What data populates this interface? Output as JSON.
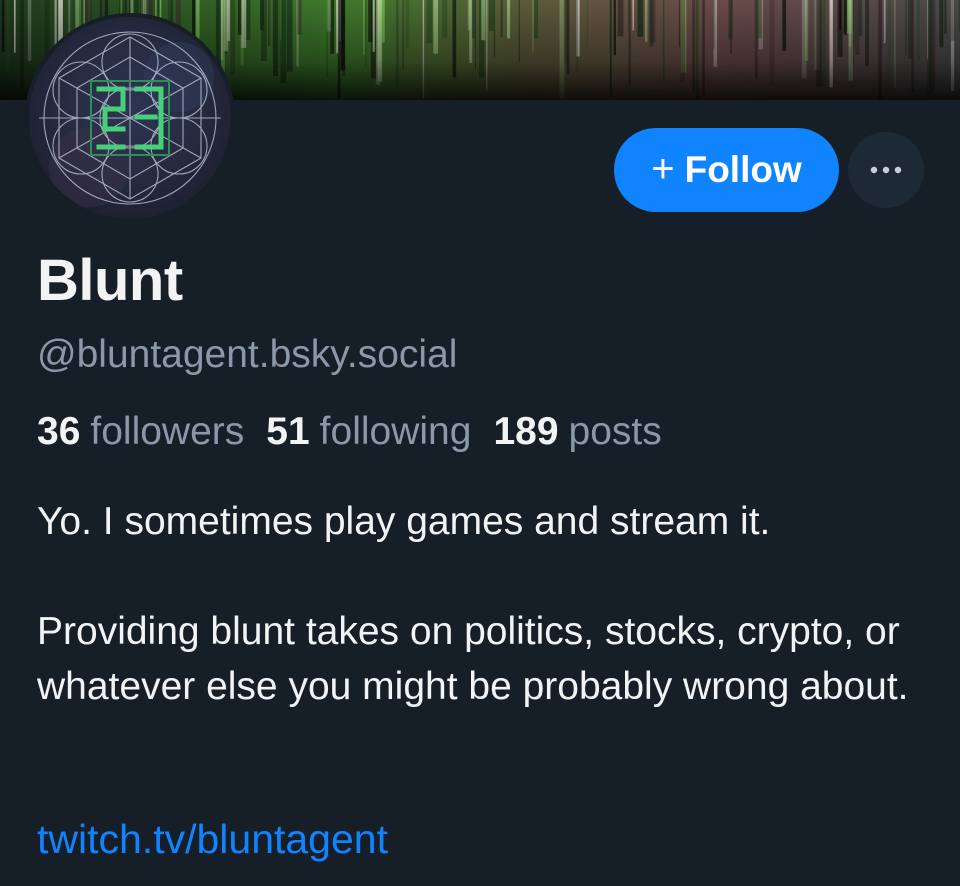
{
  "profile": {
    "display_name": "Blunt",
    "handle": "@bluntagent.bsky.social",
    "stats": {
      "followers_count": "36",
      "followers_label": "followers",
      "following_count": "51",
      "following_label": "following",
      "posts_count": "189",
      "posts_label": "posts"
    },
    "bio": {
      "line1": "Yo. I sometimes play games and stream it.",
      "line2": "Providing blunt takes on politics, stocks, crypto, or whatever else you might be probably wrong about."
    },
    "link": "twitch.tv/bluntagent"
  },
  "actions": {
    "follow_plus": "+",
    "follow_label": "Follow",
    "more_label": "···"
  },
  "colors": {
    "background": "#161e27",
    "accent": "#1083fe",
    "muted_text": "#8b98a9",
    "primary_text": "#f1f3f5",
    "secondary_button": "#1e2936"
  },
  "icons": {
    "avatar": "geometric-sigil-logo",
    "more": "ellipsis-icon",
    "follow": "plus-icon"
  }
}
